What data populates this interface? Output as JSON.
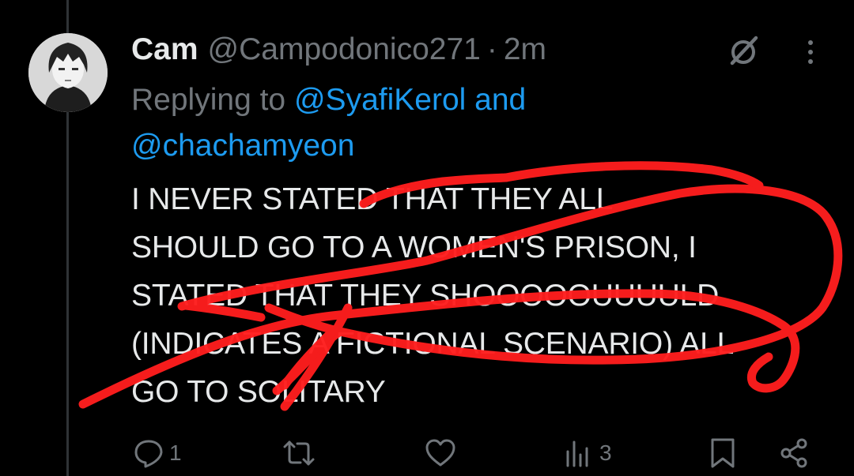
{
  "tweet": {
    "author_name": "Cam",
    "handle": "@Campodonico271",
    "separator": "·",
    "time": "2m",
    "replying_prefix": "Replying to",
    "mention_1": "@SyafiKerol",
    "mention_and": "and",
    "mention_2": "@chachamyeon",
    "text_lines": [
      "I NEVER STATED THAT THEY ALL",
      "SHOULD GO TO A WOMEN'S PRISON, I",
      "STATED THAT THEY SHOOOOOUUUULD",
      "(INDICATES A FICTIONAL SCENARIO) ALL",
      "GO TO SOLITARY"
    ]
  },
  "actions": {
    "reply_count": "1",
    "retweet_count": "",
    "like_count": "",
    "views_count": "3"
  },
  "colors": {
    "background": "#000000",
    "text": "#e7e9ea",
    "muted": "#71767b",
    "link": "#1d9bf0",
    "scribble": "#ff1e1e"
  },
  "icons": [
    "grok-icon",
    "more-icon",
    "reply-icon",
    "retweet-icon",
    "like-icon",
    "views-icon",
    "bookmark-icon",
    "share-icon"
  ]
}
